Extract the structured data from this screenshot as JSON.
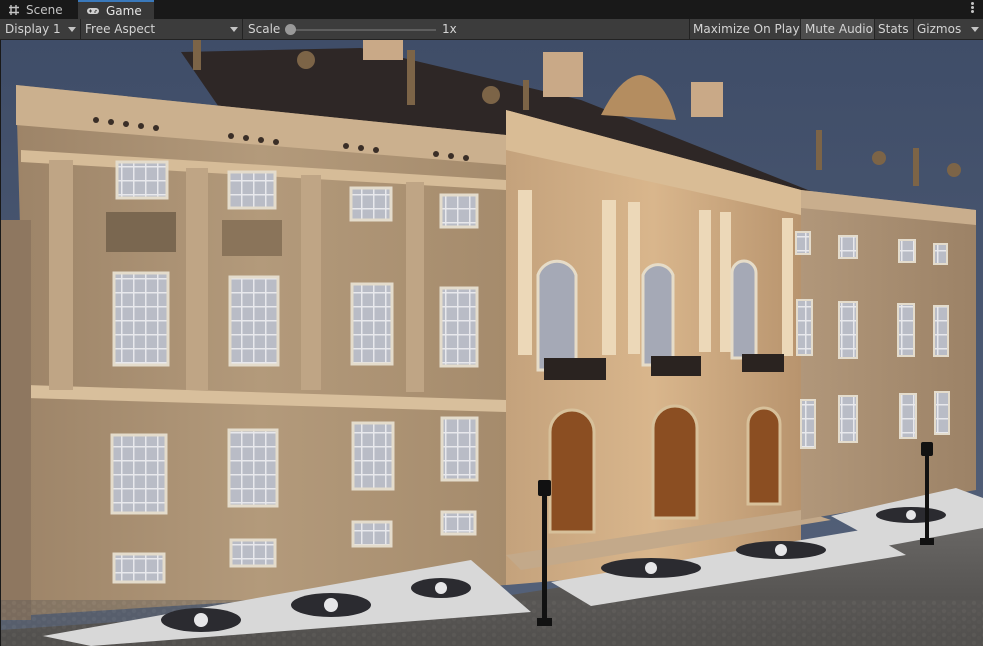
{
  "tabs": [
    {
      "label": "Scene",
      "icon": "grid-icon"
    },
    {
      "label": "Game",
      "icon": "gamepad-icon"
    }
  ],
  "toolbar": {
    "display": "Display 1",
    "aspect": "Free Aspect",
    "scale_label": "Scale",
    "scale_value": "1x",
    "maximize": "Maximize On Play",
    "mute": "Mute Audio",
    "stats": "Stats",
    "gizmos": "Gizmos"
  },
  "colors": {
    "panel": "#3c3c3c",
    "tab_active": "#383838",
    "accent": "#3a79bb",
    "sky": "#3d4a63",
    "stone": "#b59a78"
  }
}
